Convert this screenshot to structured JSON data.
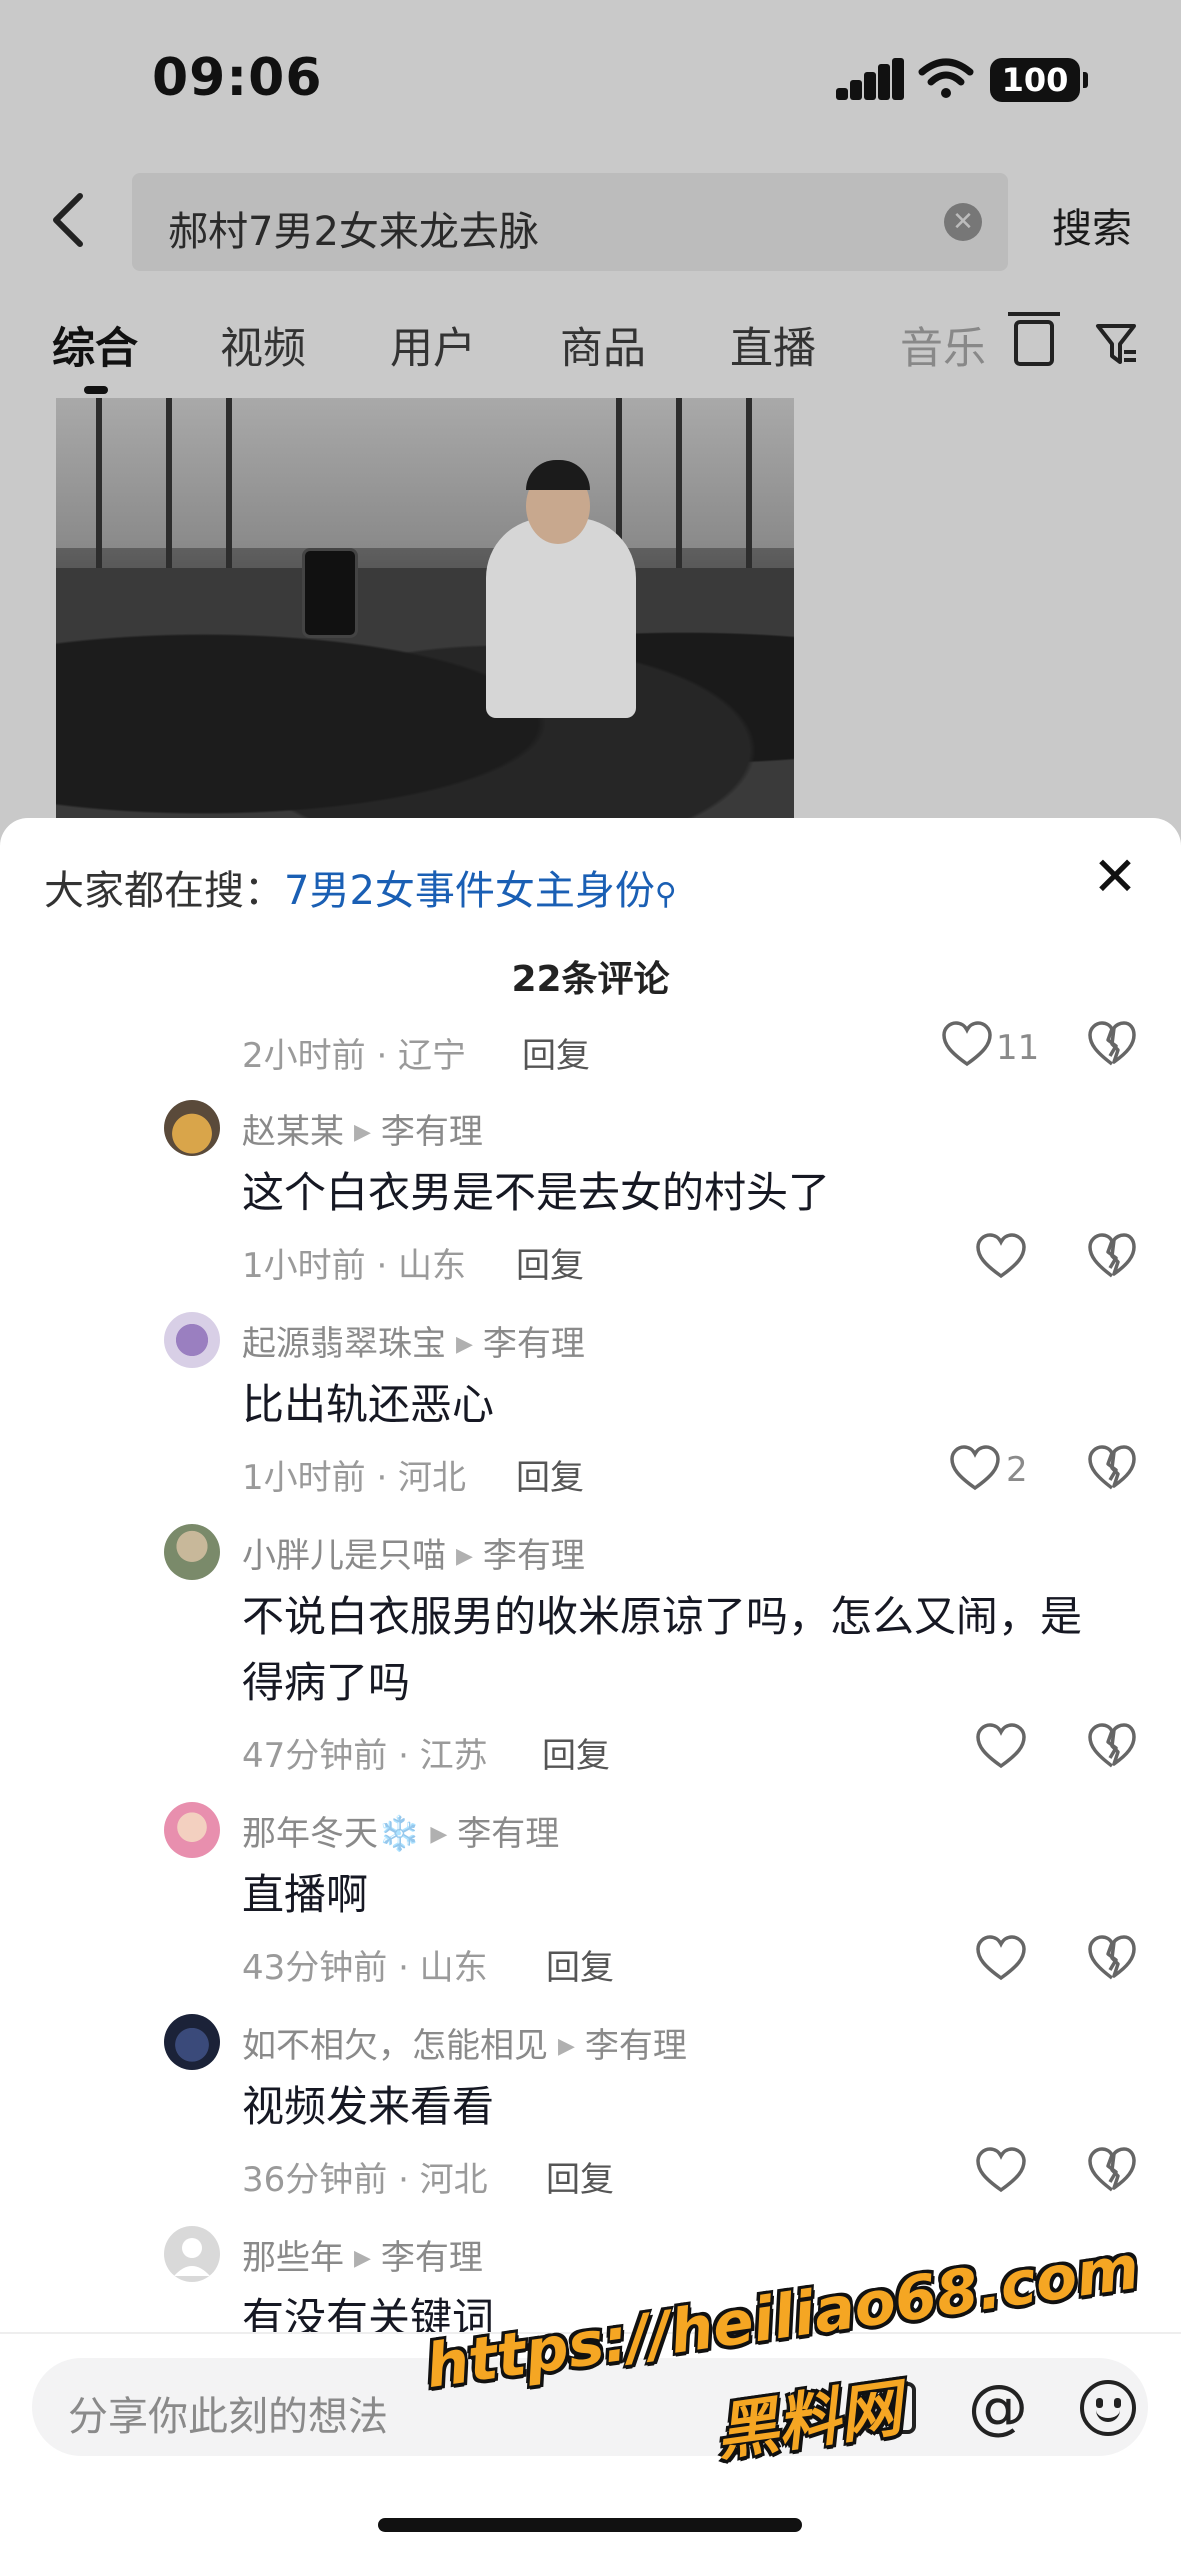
{
  "status_bar": {
    "time": "09:06",
    "battery": "100"
  },
  "search": {
    "query": "郝村7男2女来龙去脉",
    "submit_label": "搜索"
  },
  "tabs": [
    {
      "label": "综合"
    },
    {
      "label": "视频"
    },
    {
      "label": "用户"
    },
    {
      "label": "商品"
    },
    {
      "label": "直播"
    },
    {
      "label": "音乐"
    }
  ],
  "sheet": {
    "hot_label": "大家都在搜：",
    "hot_term": "7男2女事件女主身份",
    "comment_count": "22条评论"
  },
  "partial_meta": {
    "time_location": "2小时前 · 辽宁",
    "reply_label": "回复",
    "likes": "11"
  },
  "comments": [
    {
      "author": "赵某某",
      "reply_to": "李有理",
      "text": "这个白衣男是不是去女的村头了",
      "time_location": "1小时前 · 山东",
      "reply_label": "回复",
      "likes": ""
    },
    {
      "author": "起源翡翠珠宝",
      "reply_to": "李有理",
      "text": "比出轨还恶心",
      "time_location": "1小时前 · 河北",
      "reply_label": "回复",
      "likes": "2"
    },
    {
      "author": "小胖儿是只喵",
      "reply_to": "李有理",
      "text": "不说白衣服男的收米原谅了吗，怎么又闹，是得病了吗",
      "time_location": "47分钟前 · 江苏",
      "reply_label": "回复",
      "likes": ""
    },
    {
      "author": "那年冬天❄️",
      "reply_to": "李有理",
      "text": "直播啊",
      "time_location": "43分钟前 · 山东",
      "reply_label": "回复",
      "likes": ""
    },
    {
      "author": "如不相欠，怎能相见",
      "reply_to": "李有理",
      "text": "视频发来看看",
      "time_location": "36分钟前 · 河北",
      "reply_label": "回复",
      "likes": ""
    },
    {
      "author": "那些年",
      "reply_to": "李有理",
      "text": "有没有关键词",
      "time_location": "",
      "reply_label": "",
      "likes": ""
    }
  ],
  "input": {
    "placeholder": "分享你此刻的想法"
  },
  "watermark": {
    "url": "https://heiliao68.com",
    "name": "黑料网"
  },
  "colors": {
    "link": "#1a5fb4",
    "watermark": "#f5a623"
  }
}
